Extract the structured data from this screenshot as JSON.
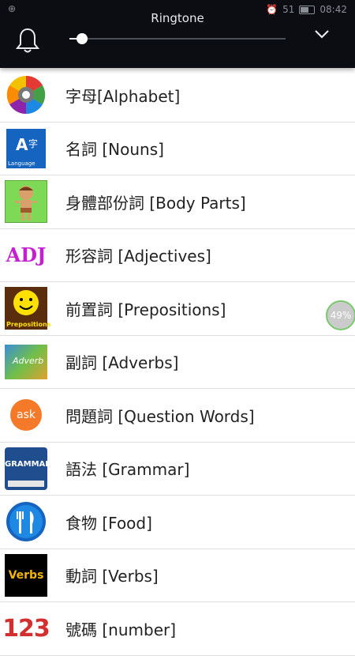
{
  "status": {
    "time": "08:42",
    "signal": "51"
  },
  "volume": {
    "title": "Ringtone",
    "level_fraction": 0.06
  },
  "items": [
    {
      "label": "字母[Alphabet]",
      "icon": "alphabet-wheel-icon"
    },
    {
      "label": "名詞 [Nouns]",
      "icon": "language-icon",
      "icon_text": "Language"
    },
    {
      "label": "身體部份詞 [Body Parts]",
      "icon": "boy-figure-icon"
    },
    {
      "label": "形容詞 [Adjectives]",
      "icon": "adj-text-icon",
      "icon_text": "ADJ"
    },
    {
      "label": "前置詞 [Prepositions]",
      "icon": "smiley-icon",
      "icon_text": "Prepositions"
    },
    {
      "label": "副詞 [Adverbs]",
      "icon": "adverb-picture-icon",
      "icon_text": "Adverb"
    },
    {
      "label": "問題詞 [Question Words]",
      "icon": "ask-bubble-icon",
      "icon_text": "ask"
    },
    {
      "label": "語法 [Grammar]",
      "icon": "grammar-book-icon",
      "icon_text": "GRAMMAR"
    },
    {
      "label": "食物 [Food]",
      "icon": "fork-knife-icon"
    },
    {
      "label": "動詞 [Verbs]",
      "icon": "verbs-text-icon",
      "icon_text": "Verbs"
    },
    {
      "label": "號碼 [number]",
      "icon": "numbers-123-icon",
      "icon_text": "123"
    }
  ],
  "progress_badge": "49%",
  "colors": {
    "overlay": "#0b0d12",
    "divider": "#e0e0e0",
    "text": "#222222"
  }
}
